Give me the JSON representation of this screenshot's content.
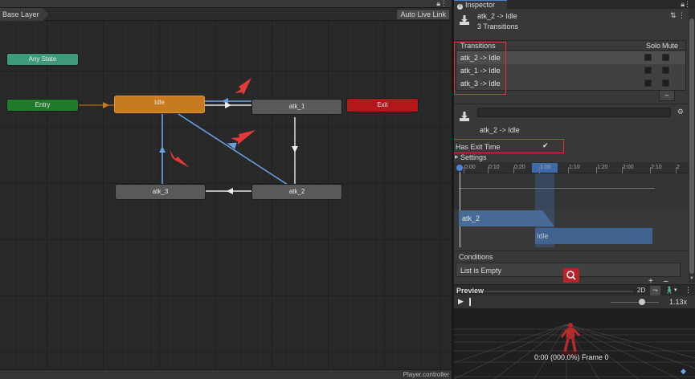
{
  "graph": {
    "layer_name": "Base Layer",
    "live_link_label": "Auto Live Link",
    "footer_file": "Player.controller",
    "nodes": {
      "any_state": "Any State",
      "entry": "Entry",
      "idle": "Idle",
      "atk_1": "atk_1",
      "exit": "Exit",
      "atk_3": "atk_3",
      "atk_2": "atk_2"
    }
  },
  "inspector": {
    "tab_label": "Inspector",
    "header": {
      "title": "atk_2 -> Idle",
      "subtitle": "3 Transitions"
    },
    "transitions": {
      "title": "Transitions",
      "solo_label": "Solo",
      "mute_label": "Mute",
      "items": [
        {
          "label": "atk_2 -> Idle",
          "selected": true
        },
        {
          "label": "atk_1 -> Idle",
          "selected": false
        },
        {
          "label": "atk_3 -> Idle",
          "selected": false
        }
      ],
      "remove_label": "–"
    },
    "selected": {
      "name_field_value": "",
      "name": "atk_2 -> Idle"
    },
    "has_exit_time": {
      "label": "Has Exit Time",
      "checked": true,
      "check_glyph": "✔"
    },
    "settings_label": "Settings",
    "timeline": {
      "ticks": [
        "0:00",
        "0:10",
        "0:20",
        "1:00",
        "1:10",
        "1:20",
        "2:00",
        "2:10",
        "2"
      ],
      "source_clip": "atk_2",
      "target_clip": "Idle"
    },
    "conditions": {
      "label": "Conditions",
      "empty_text": "List is Empty",
      "add_label": "+",
      "remove_label": "–"
    },
    "preview": {
      "label": "Preview",
      "mode_2d": "2D",
      "speed": "1.13x",
      "frame_readout": "0:00 (000.0%) Frame 0"
    }
  },
  "colors": {
    "accent": "#4b86d9",
    "default_state": "#c87a1e",
    "any_state": "#3e9a7d",
    "entry": "#1f7a2b",
    "exit": "#b3171b",
    "annotation": "#e0303a"
  }
}
